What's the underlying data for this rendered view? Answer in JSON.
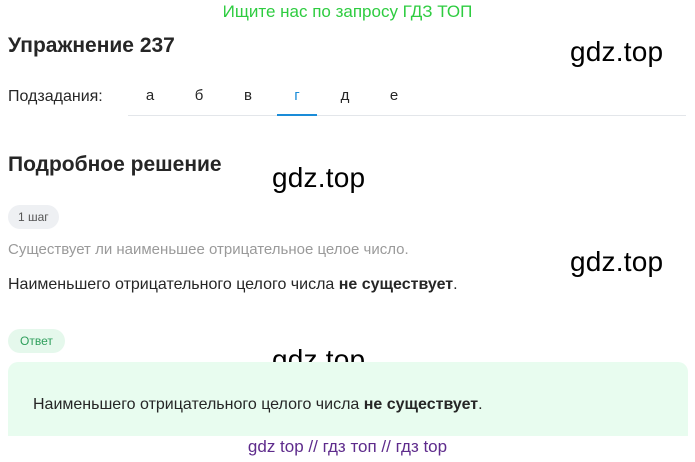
{
  "promo": {
    "text": "Ищите нас по запросу ГДЗ ТОП",
    "color": "#2ecc40"
  },
  "exercise": {
    "title": "Упражнение 237"
  },
  "watermark": "gdz.top",
  "subtasks": {
    "label": "Подзадания:",
    "tabs": [
      "а",
      "б",
      "в",
      "г",
      "д",
      "е"
    ],
    "active": "г",
    "accent_color": "#1a8cd8"
  },
  "solution": {
    "heading": "Подробное решение",
    "step_label": "1 шаг",
    "question": "Существует ли наименьшее отрицательное целое число.",
    "text_prefix": "Наименьшего отрицательного целого числа ",
    "text_bold": "не существует",
    "text_suffix": "."
  },
  "answer": {
    "label": "Ответ",
    "text_prefix": "Наименьшего отрицательного целого числа ",
    "text_bold": "не существует",
    "text_suffix": ".",
    "background_color": "#e8fcef"
  },
  "footer": {
    "text": "gdz top  //  гдз топ  //  гдз top",
    "color": "#5e2b8c"
  }
}
